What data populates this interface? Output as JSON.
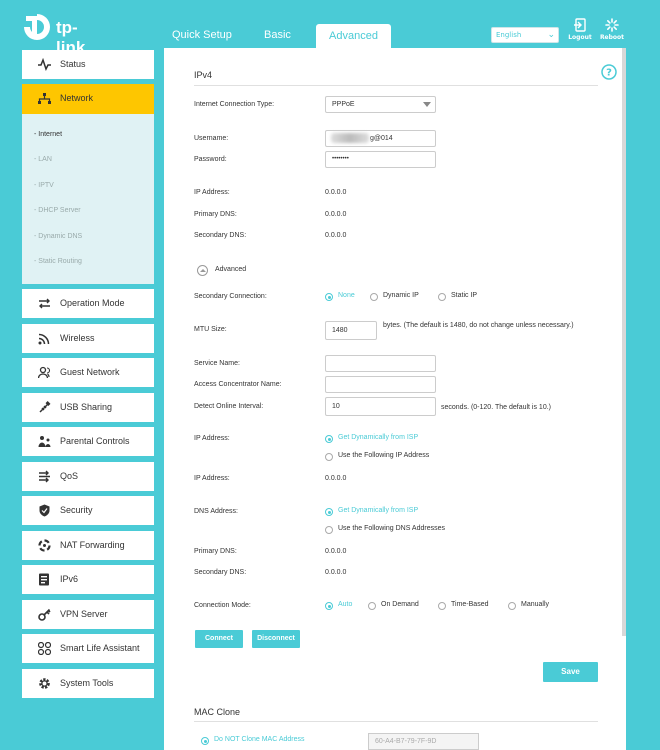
{
  "header": {
    "logo_text": "tp-link",
    "tabs": [
      "Quick Setup",
      "Basic",
      "Advanced"
    ],
    "language": "English",
    "logout_label": "Logout",
    "reboot_label": "Reboot"
  },
  "sidebar": {
    "items": [
      "Status",
      "Network",
      "Operation Mode",
      "Wireless",
      "Guest Network",
      "USB Sharing",
      "Parental Controls",
      "QoS",
      "Security",
      "NAT Forwarding",
      "IPv6",
      "VPN Server",
      "Smart Life Assistant",
      "System Tools"
    ],
    "sub_items": [
      "- Internet",
      "- LAN",
      "- IPTV",
      "- DHCP Server",
      "- Dynamic DNS",
      "- Static Routing"
    ]
  },
  "ipv4": {
    "title": "IPv4",
    "conn_type_label": "Internet Connection Type:",
    "conn_type_value": "PPPoE",
    "username_label": "Username:",
    "username_value": "g@014",
    "password_label": "Password:",
    "password_value": "••••••••",
    "ip_label": "IP Address:",
    "ip_value": "0.0.0.0",
    "pdns_label": "Primary DNS:",
    "pdns_value": "0.0.0.0",
    "sdns_label": "Secondary DNS:",
    "sdns_value": "0.0.0.0"
  },
  "advanced": {
    "toggle_label": "Advanced",
    "secondary_conn_label": "Secondary Connection:",
    "secondary_conn_options": [
      "None",
      "Dynamic IP",
      "Static IP"
    ],
    "mtu_label": "MTU Size:",
    "mtu_value": "1480",
    "mtu_hint": "bytes. (The default is 1480, do not change unless necessary.)",
    "service_name_label": "Service Name:",
    "service_name_value": "",
    "ac_name_label": "Access Concentrator Name:",
    "ac_name_value": "",
    "detect_label": "Detect Online Interval:",
    "detect_value": "10",
    "detect_hint": "seconds. (0-120. The default is 10.)",
    "ip_addr_label": "IP Address:",
    "ip_addr_options": [
      "Get Dynamically from ISP",
      "Use the Following IP Address"
    ],
    "ip_addr2_label": "IP Address:",
    "ip_addr2_value": "0.0.0.0",
    "dns_addr_label": "DNS Address:",
    "dns_addr_options": [
      "Get Dynamically from ISP",
      "Use the Following DNS Addresses"
    ],
    "pdns_label": "Primary DNS:",
    "pdns_value": "0.0.0.0",
    "sdns_label": "Secondary DNS:",
    "sdns_value": "0.0.0.0",
    "conn_mode_label": "Connection Mode:",
    "conn_mode_options": [
      "Auto",
      "On Demand",
      "Time-Based",
      "Manually"
    ],
    "connect_label": "Connect",
    "disconnect_label": "Disconnect",
    "save_label": "Save"
  },
  "mac_clone": {
    "title": "MAC Clone",
    "option_label": "Do NOT Clone MAC Address",
    "mac_value": "60-A4-B7-79-7F-9D"
  },
  "colors": {
    "accent": "#4acbd6",
    "active_nav": "#fec600"
  }
}
